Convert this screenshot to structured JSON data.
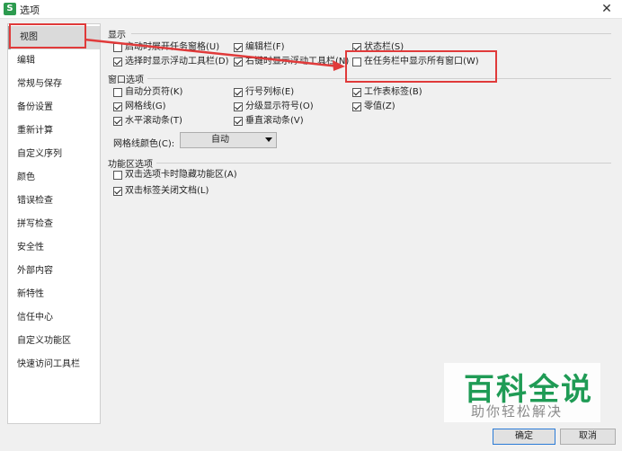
{
  "window": {
    "title": "选项",
    "app_icon_letter": "S",
    "close_glyph": "✕"
  },
  "sidebar": {
    "items": [
      {
        "label": "视图"
      },
      {
        "label": "编辑"
      },
      {
        "label": "常规与保存"
      },
      {
        "label": "备份设置"
      },
      {
        "label": "重新计算"
      },
      {
        "label": "自定义序列"
      },
      {
        "label": "颜色"
      },
      {
        "label": "错误检查"
      },
      {
        "label": "拼写检查"
      },
      {
        "label": "安全性"
      },
      {
        "label": "外部内容"
      },
      {
        "label": "新特性"
      },
      {
        "label": "信任中心"
      },
      {
        "label": "自定义功能区"
      },
      {
        "label": "快速访问工具栏"
      }
    ],
    "active_index": 0
  },
  "display": {
    "title": "显示",
    "items": [
      {
        "label": "启动时展开任务窗格(U)",
        "checked": false
      },
      {
        "label": "编辑栏(F)",
        "checked": true
      },
      {
        "label": "状态栏(S)",
        "checked": true
      },
      {
        "label": "选择时显示浮动工具栏(D)",
        "checked": true
      },
      {
        "label": "右键时显示浮动工具栏(N)",
        "checked": true
      },
      {
        "label": "在任务栏中显示所有窗口(W)",
        "checked": false
      }
    ]
  },
  "window_options": {
    "title": "窗口选项",
    "items": [
      {
        "label": "自动分页符(K)",
        "checked": false
      },
      {
        "label": "行号列标(E)",
        "checked": true
      },
      {
        "label": "工作表标签(B)",
        "checked": true
      },
      {
        "label": "网格线(G)",
        "checked": true
      },
      {
        "label": "分级显示符号(O)",
        "checked": true
      },
      {
        "label": "零值(Z)",
        "checked": true
      },
      {
        "label": "水平滚动条(T)",
        "checked": true
      },
      {
        "label": "垂直滚动条(V)",
        "checked": true
      }
    ],
    "gridline_color_label": "网格线颜色(C):",
    "gridline_color_value": "自动"
  },
  "ribbon_options": {
    "title": "功能区选项",
    "items": [
      {
        "label": "双击选项卡时隐藏功能区(A)",
        "checked": false
      },
      {
        "label": "双击标签关闭文档(L)",
        "checked": true
      }
    ]
  },
  "buttons": {
    "ok": "确定",
    "cancel": "取消"
  },
  "annotation_color": "#e03a3a",
  "watermark": {
    "main": "百科全说",
    "sub": "助你轻松解决"
  }
}
